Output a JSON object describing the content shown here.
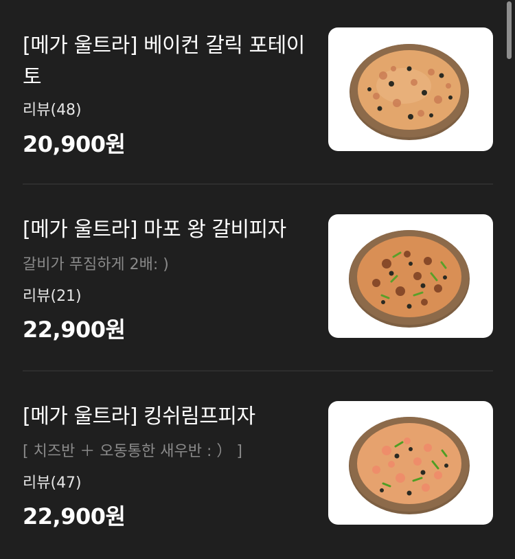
{
  "menu": {
    "items": [
      {
        "title": "[메가 울트라] 베이컨 갈릭 포테이토",
        "subtitle": "",
        "review": "리뷰(48)",
        "price": "20,900원",
        "image_icon": "pizza-bacon-garlic-potato"
      },
      {
        "title": "[메가 울트라] 마포 왕 갈비피자",
        "subtitle": "갈비가 푸짐하게 2배: )",
        "review": "리뷰(21)",
        "price": "22,900원",
        "image_icon": "pizza-galbi"
      },
      {
        "title": "[메가 울트라] 킹쉬림프피자",
        "subtitle": "[ 치즈반 ＋ 오동통한 새우반 : ） ]",
        "review": "리뷰(47)",
        "price": "22,900원",
        "image_icon": "pizza-king-shrimp"
      }
    ]
  },
  "colors": {
    "background": "#1f1f1f",
    "text_primary": "#ffffff",
    "text_secondary": "#8a8a8a",
    "divider": "#2e2e2e",
    "crust": "#8a6a4a",
    "cheese": "#e0a46a"
  }
}
